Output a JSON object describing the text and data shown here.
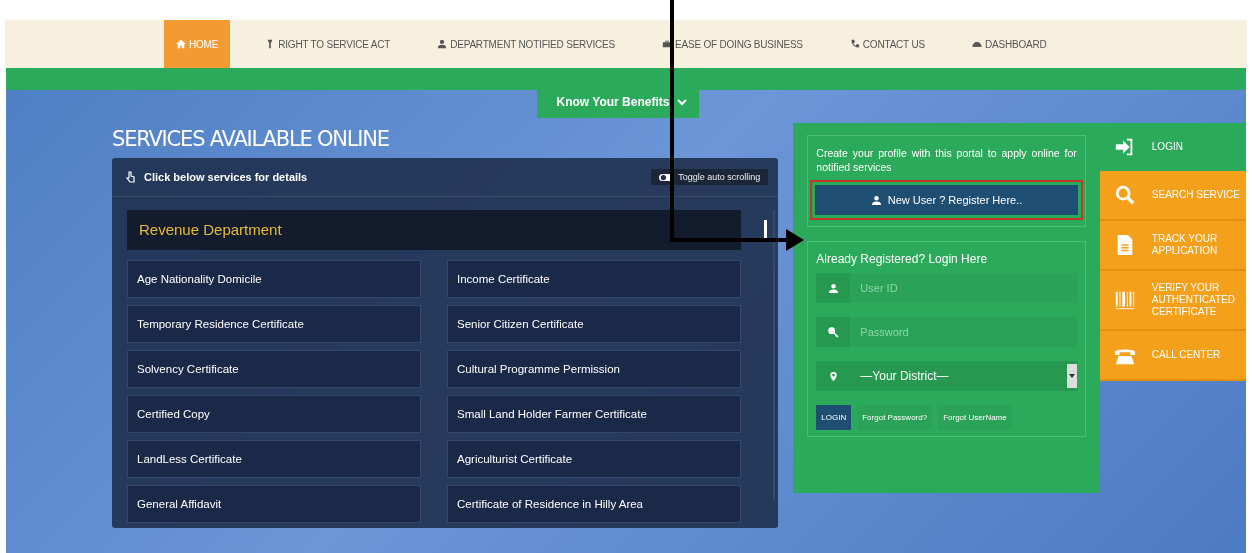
{
  "nav": [
    {
      "label": "HOME",
      "kind": "home",
      "selected": true
    },
    {
      "label": "RIGHT TO SERVICE ACT",
      "kind": "torch",
      "selected": false
    },
    {
      "label": "DEPARTMENT NOTIFIED SERVICES",
      "kind": "user",
      "selected": false
    },
    {
      "label": "EASE OF DOING BUSINESS",
      "kind": "briefcase",
      "selected": false
    },
    {
      "label": "CONTACT US",
      "kind": "phone",
      "selected": false
    },
    {
      "label": "DASHBOARD",
      "kind": "gauge",
      "selected": false
    }
  ],
  "benefits_tab": {
    "label": "Know Your Benefits"
  },
  "section_title": "SERVICES AVAILABLE ONLINE",
  "services_panel": {
    "hint": "Click below services for details",
    "toggle_label": "Toggle auto scrolling",
    "department": "Revenue Department",
    "items": [
      "Age Nationality Domicile",
      "Income Certificate",
      "Temporary Residence Certificate",
      "Senior Citizen Certificate",
      "Solvency Certificate",
      "Cultural Programme Permission",
      "Certified Copy",
      "Small Land Holder Farmer Certificate",
      "LandLess Certificate",
      "Agriculturist Certificate",
      "General Affidavit",
      "Certificate of Residence in Hilly Area"
    ]
  },
  "register": {
    "intro": "Create your profile with this portal to apply online for notified services",
    "button": "New User ? Register Here.."
  },
  "login": {
    "heading": "Already Registered? Login Here",
    "fields": [
      {
        "kind": "text",
        "placeholder": "User ID"
      },
      {
        "kind": "password",
        "placeholder": "Password"
      },
      {
        "kind": "select",
        "value": "—Your District—"
      }
    ],
    "submit": "LOGIN",
    "links": [
      "Forgot Password?",
      "Forgot UserName"
    ]
  },
  "side_menu": [
    {
      "label": "LOGIN",
      "kind": "signin",
      "selected": true
    },
    {
      "label": "SEARCH SERVICE",
      "kind": "search",
      "selected": false
    },
    {
      "label": "TRACK YOUR APPLICATION",
      "kind": "document",
      "selected": false
    },
    {
      "label": "VERIFY YOUR AUTHENTICATED CERTIFICATE",
      "kind": "barcode",
      "selected": false
    },
    {
      "label": "CALL CENTER",
      "kind": "telephone",
      "selected": false
    }
  ]
}
